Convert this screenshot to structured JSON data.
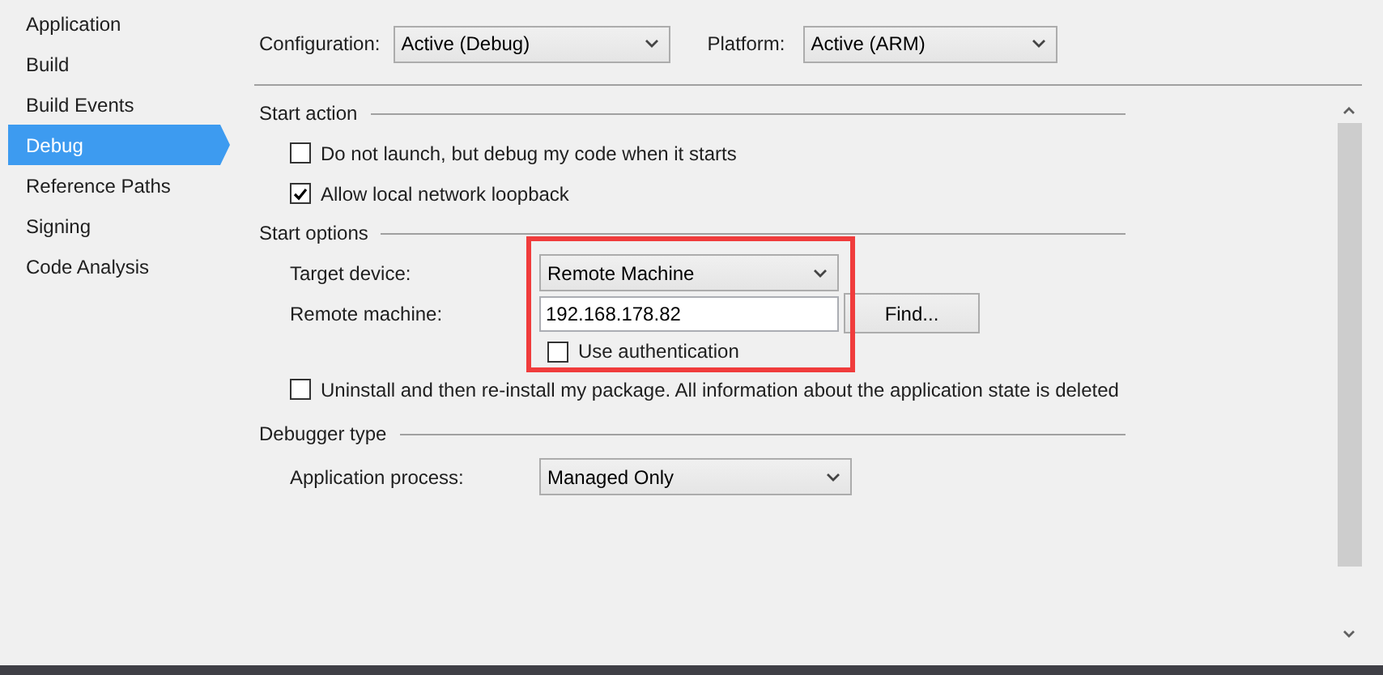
{
  "sidebar": {
    "items": [
      {
        "label": "Application",
        "selected": false
      },
      {
        "label": "Build",
        "selected": false
      },
      {
        "label": "Build Events",
        "selected": false
      },
      {
        "label": "Debug",
        "selected": true
      },
      {
        "label": "Reference Paths",
        "selected": false
      },
      {
        "label": "Signing",
        "selected": false
      },
      {
        "label": "Code Analysis",
        "selected": false
      }
    ]
  },
  "toolbar": {
    "configuration": {
      "label": "Configuration:",
      "value": "Active (Debug)"
    },
    "platform": {
      "label": "Platform:",
      "value": "Active (ARM)"
    }
  },
  "sections": [
    {
      "title": "Start action",
      "rows": [
        {
          "kind": "checkbox",
          "label": "Do not launch, but debug my code when it starts",
          "checked": false
        },
        {
          "kind": "checkbox",
          "label": "Allow local network loopback",
          "checked": true
        }
      ]
    },
    {
      "title": "Start options",
      "rows": [
        {
          "kind": "dropdown",
          "label": "Target device:",
          "value": "Remote Machine"
        },
        {
          "kind": "textfield",
          "label": "Remote machine:",
          "value": "192.168.178.82",
          "button": "Find..."
        },
        {
          "kind": "subcheckbox",
          "label": "Use authentication",
          "checked": false
        },
        {
          "kind": "checkbox",
          "label": "Uninstall and then re-install my package. All information about the application state is deleted",
          "checked": false
        }
      ]
    },
    {
      "title": "Debugger type",
      "rows": [
        {
          "kind": "dropdown",
          "label": "Application process:",
          "value": "Managed Only"
        }
      ]
    }
  ]
}
